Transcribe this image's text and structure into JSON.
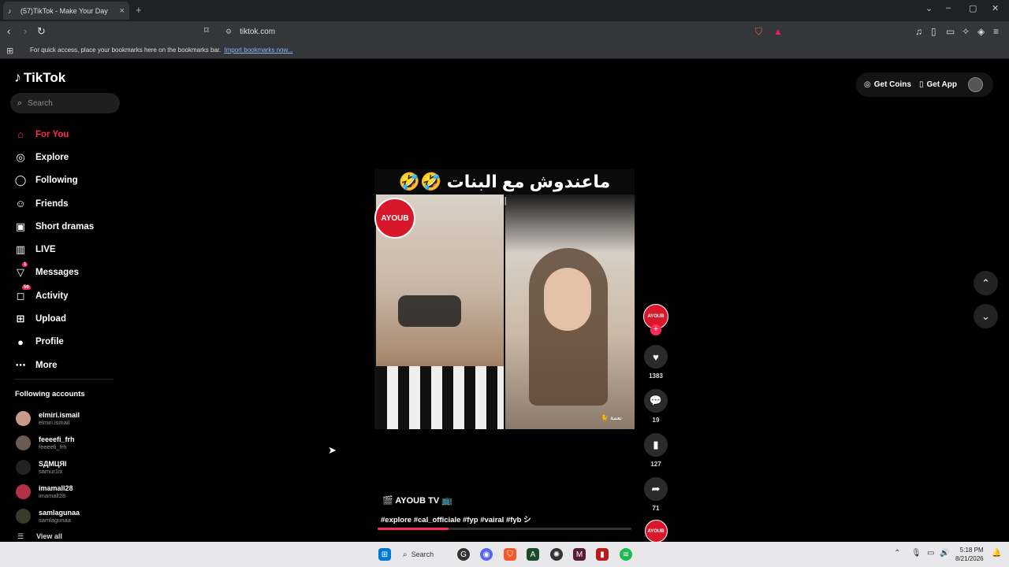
{
  "browser": {
    "tab_title": "(57)TikTok - Make Your Day",
    "url": "tiktok.com",
    "bookmarks_msg": "For quick access, place your bookmarks here on the bookmarks bar.",
    "bookmarks_link": "Import bookmarks now..."
  },
  "sidebar": {
    "brand": "TikTok",
    "search_placeholder": "Search",
    "items": [
      {
        "label": "For You",
        "icon": "home-icon",
        "glyph": "⌂"
      },
      {
        "label": "Explore",
        "icon": "compass-icon",
        "glyph": "◎"
      },
      {
        "label": "Following",
        "icon": "following-icon",
        "glyph": "◯"
      },
      {
        "label": "Friends",
        "icon": "friends-icon",
        "glyph": "☺"
      },
      {
        "label": "Short dramas",
        "icon": "film-icon",
        "glyph": "▣"
      },
      {
        "label": "LIVE",
        "icon": "live-icon",
        "glyph": "▥"
      },
      {
        "label": "Messages",
        "icon": "messages-icon",
        "glyph": "▽",
        "badge": "1"
      },
      {
        "label": "Activity",
        "icon": "activity-icon",
        "glyph": "◻",
        "badge": "56"
      },
      {
        "label": "Upload",
        "icon": "upload-icon",
        "glyph": "⊞"
      },
      {
        "label": "Profile",
        "icon": "profile-avatar-icon",
        "glyph": "●"
      },
      {
        "label": "More",
        "icon": "more-icon",
        "glyph": "⋯"
      }
    ],
    "following_title": "Following accounts",
    "following": [
      {
        "name": "elmiri.ismail",
        "handle": "elmiri.ismail",
        "color": "#c99a8a"
      },
      {
        "name": "feeeefi_frh",
        "handle": "feeeefi_frh",
        "color": "#6a5a50"
      },
      {
        "name": "SДMЦЯI",
        "handle": "samur1ix",
        "color": "#222222"
      },
      {
        "name": "imamall28",
        "handle": "imamall28",
        "color": "#b0324a"
      },
      {
        "name": "samlagunaa",
        "handle": "samlagunaa",
        "color": "#3a3a2a"
      }
    ],
    "view_all": "View all"
  },
  "header": {
    "get_coins": "Get Coins",
    "get_app": "Get App"
  },
  "video": {
    "caption": "ماعندوش مع البنات 🤣🤣",
    "channel_badge": "AYOUB",
    "tag": "🐈 نعمة",
    "author": "🎬 AYOUB TV 📺",
    "description": "#explore #cal_officiale #fyp #vairal #fyb シ",
    "progress": 0.28
  },
  "actions": {
    "likes": "1383",
    "comments": "19",
    "saves": "127",
    "shares": "71",
    "avatar_text": "AYOUB"
  },
  "taskbar": {
    "search": "Search",
    "time": "5:18 PM",
    "date": "8/21/2026"
  },
  "colors": {
    "accent": "#fe2c55",
    "background": "#000000"
  }
}
